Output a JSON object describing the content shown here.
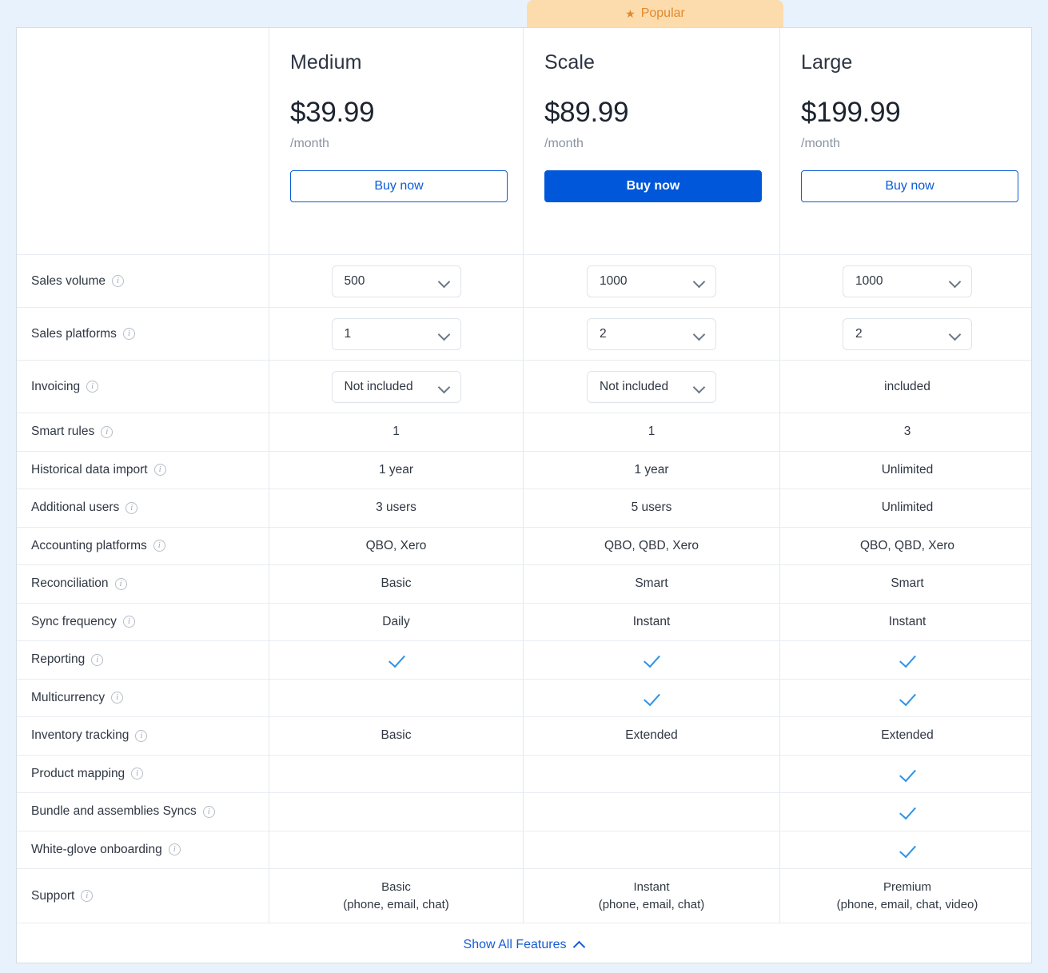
{
  "badge": {
    "label": "Popular",
    "star_icon": "star-icon",
    "bg_color": "#fcdcad",
    "text_color": "#e08a2e"
  },
  "colors": {
    "page_background": "#e8f2fd",
    "accent_blue": "#0057d9",
    "link_blue": "#155cd3",
    "check_blue": "#2e92e8",
    "border": "#e3e8ee"
  },
  "plans": [
    {
      "name": "Medium",
      "price": "$39.99",
      "period": "/month",
      "buy_label": "Buy now",
      "highlighted": false
    },
    {
      "name": "Scale",
      "price": "$89.99",
      "period": "/month",
      "buy_label": "Buy now",
      "highlighted": true
    },
    {
      "name": "Large",
      "price": "$199.99",
      "period": "/month",
      "buy_label": "Buy now",
      "highlighted": false
    }
  ],
  "features": [
    {
      "label": "Sales volume",
      "medium": {
        "type": "select",
        "value": "500"
      },
      "scale": {
        "type": "select",
        "value": "1000"
      },
      "large": {
        "type": "select",
        "value": "1000"
      }
    },
    {
      "label": "Sales platforms",
      "medium": {
        "type": "select",
        "value": "1"
      },
      "scale": {
        "type": "select",
        "value": "2"
      },
      "large": {
        "type": "select",
        "value": "2"
      }
    },
    {
      "label": "Invoicing",
      "medium": {
        "type": "select",
        "value": "Not included"
      },
      "scale": {
        "type": "select",
        "value": "Not included"
      },
      "large": {
        "type": "text",
        "value": "included"
      }
    },
    {
      "label": "Smart rules",
      "medium": {
        "type": "text",
        "value": "1"
      },
      "scale": {
        "type": "text",
        "value": "1"
      },
      "large": {
        "type": "text",
        "value": "3"
      }
    },
    {
      "label": "Historical data import",
      "medium": {
        "type": "text",
        "value": "1 year"
      },
      "scale": {
        "type": "text",
        "value": "1 year"
      },
      "large": {
        "type": "text",
        "value": "Unlimited"
      }
    },
    {
      "label": "Additional users",
      "medium": {
        "type": "text",
        "value": "3 users"
      },
      "scale": {
        "type": "text",
        "value": "5 users"
      },
      "large": {
        "type": "text",
        "value": "Unlimited"
      }
    },
    {
      "label": "Accounting platforms",
      "medium": {
        "type": "text",
        "value": "QBO, Xero"
      },
      "scale": {
        "type": "text",
        "value": "QBO, QBD, Xero"
      },
      "large": {
        "type": "text",
        "value": "QBO, QBD, Xero"
      }
    },
    {
      "label": "Reconciliation",
      "medium": {
        "type": "text",
        "value": "Basic"
      },
      "scale": {
        "type": "text",
        "value": "Smart"
      },
      "large": {
        "type": "text",
        "value": "Smart"
      }
    },
    {
      "label": "Sync frequency",
      "medium": {
        "type": "text",
        "value": "Daily"
      },
      "scale": {
        "type": "text",
        "value": "Instant"
      },
      "large": {
        "type": "text",
        "value": "Instant"
      }
    },
    {
      "label": "Reporting",
      "medium": {
        "type": "check",
        "value": ""
      },
      "scale": {
        "type": "check",
        "value": ""
      },
      "large": {
        "type": "check",
        "value": ""
      }
    },
    {
      "label": "Multicurrency",
      "medium": {
        "type": "empty",
        "value": ""
      },
      "scale": {
        "type": "check",
        "value": ""
      },
      "large": {
        "type": "check",
        "value": ""
      }
    },
    {
      "label": "Inventory tracking",
      "medium": {
        "type": "text",
        "value": "Basic"
      },
      "scale": {
        "type": "text",
        "value": "Extended"
      },
      "large": {
        "type": "text",
        "value": "Extended"
      }
    },
    {
      "label": "Product mapping",
      "medium": {
        "type": "empty",
        "value": ""
      },
      "scale": {
        "type": "empty",
        "value": ""
      },
      "large": {
        "type": "check",
        "value": ""
      }
    },
    {
      "label": "Bundle and assemblies Syncs",
      "medium": {
        "type": "empty",
        "value": ""
      },
      "scale": {
        "type": "empty",
        "value": ""
      },
      "large": {
        "type": "check",
        "value": ""
      }
    },
    {
      "label": "White-glove onboarding",
      "medium": {
        "type": "empty",
        "value": ""
      },
      "scale": {
        "type": "empty",
        "value": ""
      },
      "large": {
        "type": "check",
        "value": ""
      }
    },
    {
      "label": "Support",
      "medium": {
        "type": "text2",
        "value": "Basic",
        "value2": "(phone, email, chat)"
      },
      "scale": {
        "type": "text2",
        "value": "Instant",
        "value2": "(phone, email, chat)"
      },
      "large": {
        "type": "text2",
        "value": "Premium",
        "value2": "(phone, email, chat, video)"
      }
    }
  ],
  "footer": {
    "show_all_label": "Show All Features",
    "chevron_icon": "chevron-up-icon"
  },
  "info_icon_glyph": "i"
}
